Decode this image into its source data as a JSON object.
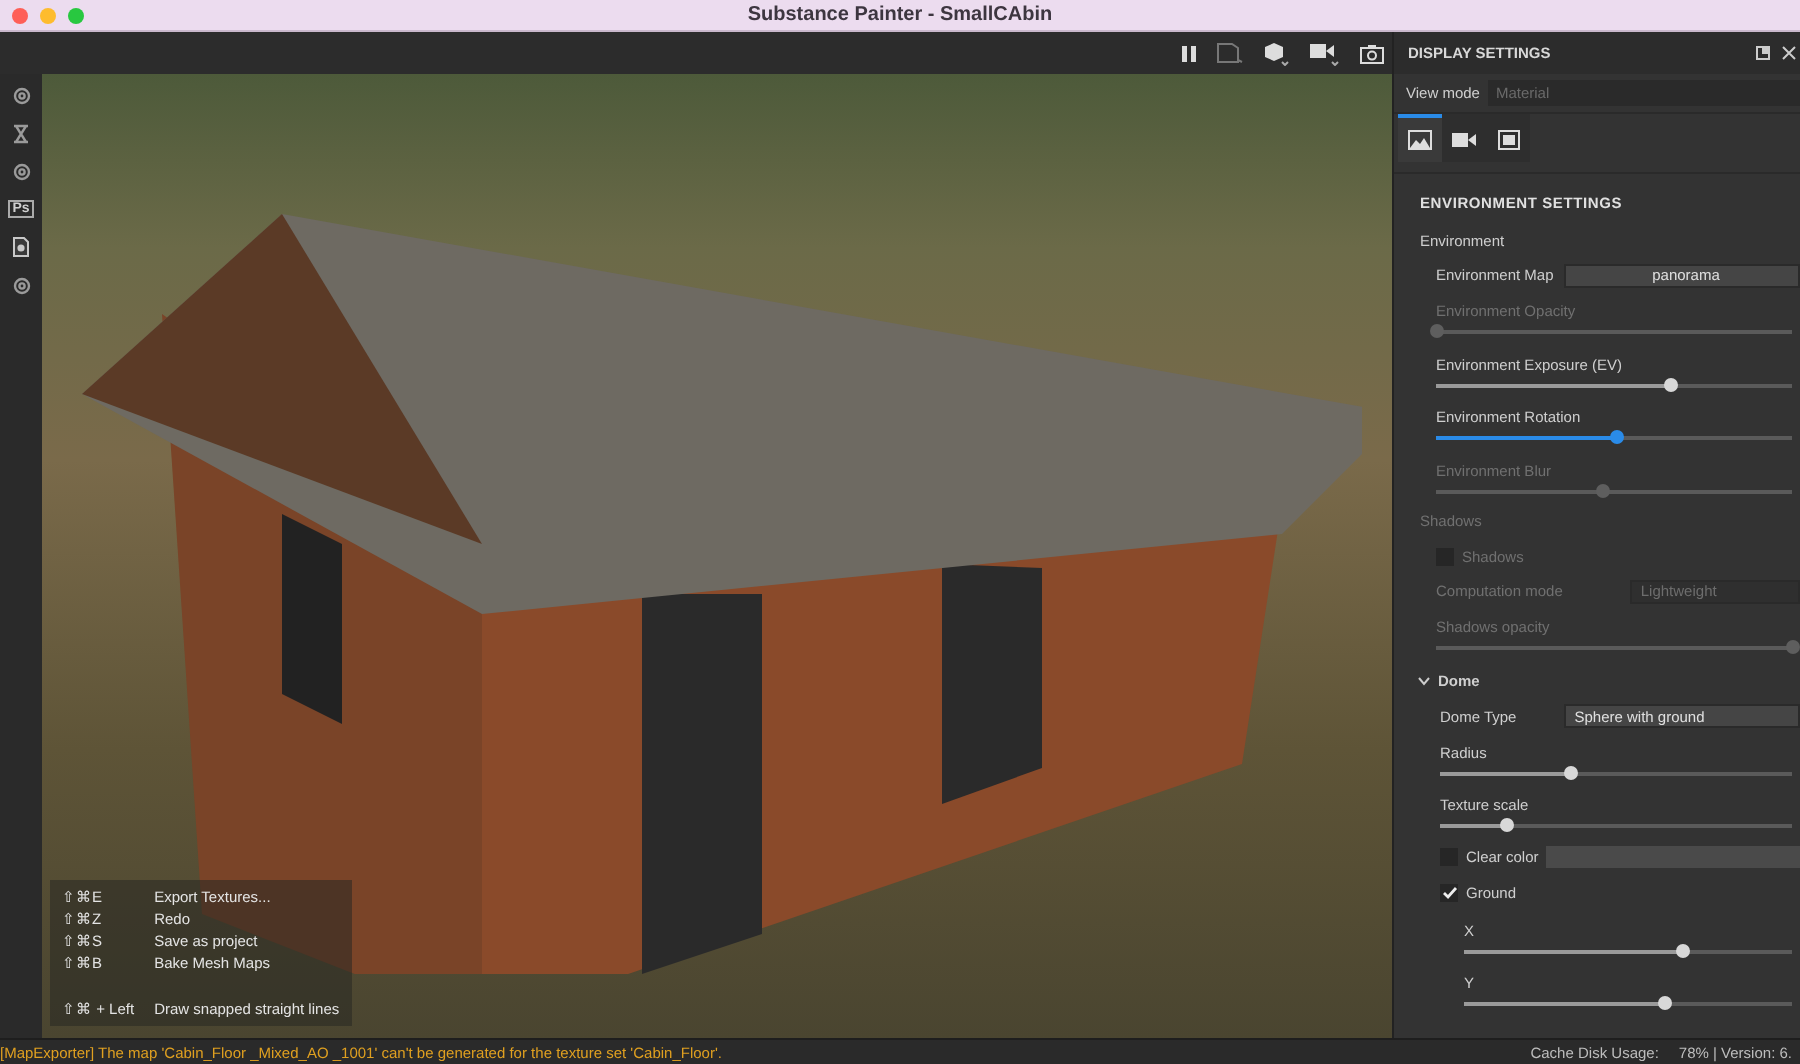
{
  "window": {
    "title": "Substance Painter - SmallCAbin"
  },
  "sidebar": {
    "items": [
      {
        "kind": "gear"
      },
      {
        "kind": "hourglass"
      },
      {
        "kind": "gear"
      },
      {
        "kind": "text",
        "label": "Ps"
      },
      {
        "kind": "doc"
      },
      {
        "kind": "gear"
      }
    ]
  },
  "viewport": {
    "shortcuts": [
      {
        "keys": "⇧⌘E",
        "action": "Export Textures..."
      },
      {
        "keys": "⇧⌘Z",
        "action": "Redo"
      },
      {
        "keys": "⇧⌘S",
        "action": "Save as project"
      },
      {
        "keys": "⇧⌘B",
        "action": "Bake Mesh Maps"
      },
      {
        "keys": "⇧⌘ + Left",
        "action": "Draw snapped straight lines",
        "gap": true
      }
    ]
  },
  "panel": {
    "title": "DISPLAY SETTINGS",
    "view_mode": {
      "label": "View mode",
      "value": "Material"
    },
    "tabs": [
      {
        "kind": "image",
        "selected": true
      },
      {
        "kind": "camera",
        "selected": false
      },
      {
        "kind": "frame",
        "selected": false
      }
    ],
    "heading": "ENVIRONMENT SETTINGS",
    "rows": [
      {
        "kind": "group",
        "label": "Environment",
        "disabled": false
      },
      {
        "kind": "select",
        "label": "Environment Map",
        "value": "panorama",
        "disabled": false,
        "centered": true
      },
      {
        "kind": "slider",
        "label": "Environment Opacity",
        "level": 0,
        "disabled": true,
        "active": false
      },
      {
        "kind": "slider",
        "label": "Environment Exposure (EV)",
        "level": 0.66,
        "disabled": false,
        "active": false
      },
      {
        "kind": "slider",
        "label": "Environment Rotation",
        "level": 0.51,
        "disabled": false,
        "active": true
      },
      {
        "kind": "slider",
        "label": "Environment Blur",
        "level": 0.47,
        "disabled": true,
        "active": false
      },
      {
        "kind": "group",
        "label": "Shadows",
        "disabled": true
      },
      {
        "kind": "checkbox",
        "label": "Shadows",
        "checked": false,
        "disabled": true
      },
      {
        "kind": "select",
        "label": "Computation mode",
        "value": "Lightweight",
        "disabled": true,
        "centered": false
      },
      {
        "kind": "slider",
        "label": "Shadows opacity",
        "level": 1,
        "disabled": true,
        "active": false
      },
      {
        "kind": "section",
        "label": "Dome",
        "expanded": true,
        "children": [
          {
            "kind": "select",
            "label": "Dome Type",
            "value": "Sphere with ground",
            "disabled": false,
            "centered": false
          },
          {
            "kind": "slider",
            "label": "Radius",
            "level": 0.37,
            "disabled": false,
            "active": false
          },
          {
            "kind": "slider",
            "label": "Texture scale",
            "level": 0.19,
            "disabled": false,
            "active": false
          },
          {
            "kind": "color",
            "label": "Clear color",
            "checked": false,
            "disabled": false
          },
          {
            "kind": "checkbox",
            "label": "Ground",
            "checked": true,
            "disabled": false,
            "children": [
              {
                "kind": "slider",
                "label": "X",
                "level": 0.67,
                "disabled": false,
                "active": false
              },
              {
                "kind": "slider",
                "label": "Y",
                "level": 0.61,
                "disabled": false,
                "active": false
              }
            ]
          }
        ]
      }
    ]
  },
  "status_bar": {
    "message": "[MapExporter] The map 'Cabin_Floor _Mixed_AO _1001' can't be generated for the texture set 'Cabin_Floor'.",
    "cache_label": "Cache Disk Usage:",
    "cache_value": "78% | Version: 6."
  }
}
